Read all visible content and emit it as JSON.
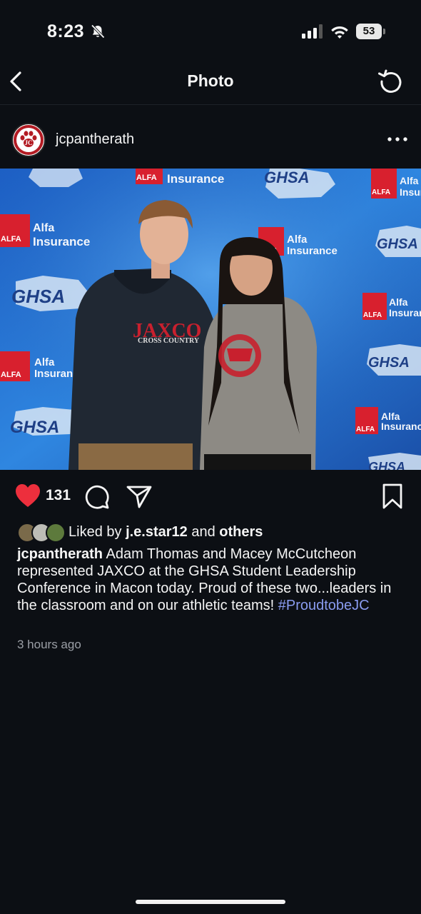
{
  "status_bar": {
    "time": "8:23",
    "battery": "53"
  },
  "nav": {
    "title": "Photo"
  },
  "post": {
    "username": "jcpantherath",
    "photo_texts": {
      "sponsor": "Alfa",
      "insurance": "Insurance",
      "ghsa": "GHSA",
      "alfa_logo": "ALFA",
      "shirt_jaxco": "JAXCO",
      "shirt_sub": "CROSS COUNTRY"
    },
    "like_count": "131",
    "liked_by_prefix": "Liked by",
    "liked_by_user": "j.e.star12",
    "liked_by_and": "and",
    "liked_by_others": "others",
    "caption_user": "jcpantherath",
    "caption_text": "Adam Thomas and Macey McCutcheon represented JAXCO at the GHSA Student Leadership Conference in Macon today.  Proud of these two...leaders in the classroom and on our athletic teams!",
    "caption_hashtag": "#ProudtobeJC",
    "timestamp": "3 hours ago"
  },
  "colors": {
    "background": "#0c0f14",
    "like_red": "#ed2f3d",
    "hashtag": "#8a9cf0",
    "muted_text": "#9b9fa6"
  },
  "icons": [
    "bell-off-icon",
    "signal-icon",
    "wifi-icon",
    "battery-icon",
    "back-chevron-icon",
    "refresh-icon",
    "more-dots-icon",
    "heart-icon",
    "comment-icon",
    "share-icon",
    "bookmark-icon"
  ]
}
